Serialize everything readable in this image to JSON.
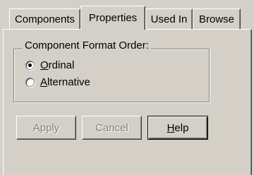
{
  "tabs": [
    {
      "label": "Components",
      "active": false
    },
    {
      "label": "Properties",
      "active": true
    },
    {
      "label": "Used In",
      "active": false
    },
    {
      "label": "Browse",
      "active": false
    }
  ],
  "group": {
    "legend": "Component Format Order:",
    "options": [
      {
        "label": "Ordinal",
        "underline": "O",
        "rest": "rdinal",
        "selected": true
      },
      {
        "label": "Alternative",
        "underline": "A",
        "rest": "lternative",
        "selected": false
      }
    ]
  },
  "buttons": {
    "apply": "Apply",
    "cancel": "Cancel",
    "help_underline": "H",
    "help_rest": "elp"
  },
  "colors": {
    "face": "#d4d0c8",
    "disabled_text": "#808080"
  }
}
